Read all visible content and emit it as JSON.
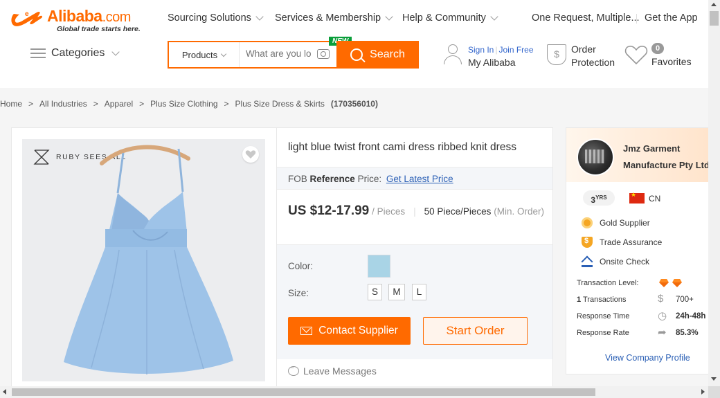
{
  "header": {
    "logo_text": "Alibaba",
    "logo_suffix": ".com",
    "logo_tagline": "Global trade starts here.",
    "nav": {
      "sourcing": "Sourcing Solutions",
      "services": "Services & Membership",
      "help": "Help & Community",
      "one_request": "One Request, Multiple...",
      "get_app": "Get the App"
    },
    "categories_label": "Categories",
    "search": {
      "category": "Products",
      "placeholder": "What are you lo",
      "button_label": "Search",
      "new_badge": "NEW"
    },
    "account": {
      "sign_in": "Sign In",
      "join_free": "Join Free",
      "my_alibaba": "My Alibaba"
    },
    "order_protection": {
      "line1": "Order",
      "line2": "Protection"
    },
    "favorites": {
      "count": "0",
      "label": "Favorites"
    }
  },
  "breadcrumb": {
    "items": [
      "Home",
      "All Industries",
      "Apparel",
      "Plus Size Clothing",
      "Plus Size Dress & Skirts"
    ],
    "product_id": "(170356010)"
  },
  "product": {
    "brand_watermark": "RUBY SEES ALL",
    "title": "light blue twist front cami dress ribbed knit dress",
    "fob_prefix": "FOB",
    "fob_reference": "Reference",
    "fob_suffix": "Price:",
    "latest_price_link": "Get Latest Price",
    "price": "US $12-17.99",
    "price_unit": "/ Pieces",
    "moq": "50 Piece/Pieces",
    "moq_note": "(Min. Order)",
    "color_label": "Color:",
    "size_label": "Size:",
    "sizes": [
      "S",
      "M",
      "L"
    ],
    "contact_button": "Contact Supplier",
    "start_order_button": "Start Order",
    "leave_messages": "Leave Messages",
    "swatch_color": "#a9d4e6",
    "dress_color": "#9ec3e8"
  },
  "supplier": {
    "name_line1": "Jmz Garment",
    "name_line2": "Manufacture Pty Ltd",
    "years": "3",
    "years_unit": "YRS",
    "country": "CN",
    "gold_supplier": "Gold Supplier",
    "trade_assurance": "Trade Assurance",
    "onsite_check": "Onsite Check",
    "transaction_level_label": "Transaction Level:",
    "transactions_count": "1",
    "transactions_label": "Transactions",
    "transactions_value": "700+",
    "response_time_label": "Response Time",
    "response_time_value": "24h-48h",
    "response_rate_label": "Response Rate",
    "response_rate_value": "85.3%",
    "view_profile": "View Company Profile"
  },
  "colors": {
    "accent": "#ff6a00",
    "link": "#2a5fb5",
    "new_badge": "#0a9e3a"
  }
}
